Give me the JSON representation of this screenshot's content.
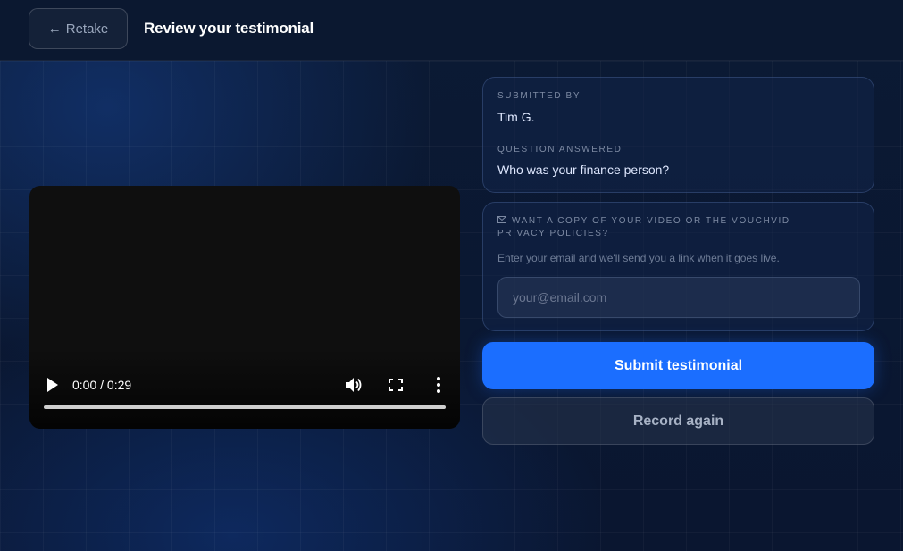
{
  "header": {
    "retake_label": "Retake",
    "title": "Review your testimonial"
  },
  "video": {
    "time": "0:00 / 0:29",
    "progress": 0
  },
  "info": {
    "submitted_by_label": "SUBMITTED BY",
    "submitted_by": "Tim G.",
    "question_label": "QUESTION ANSWERED",
    "question": "Who was your finance person?"
  },
  "email": {
    "title": "WANT A COPY OF YOUR VIDEO OR THE VOUCHVID PRIVACY POLICIES?",
    "description": "Enter your email and we'll send you a link when it goes live.",
    "placeholder": "your@email.com",
    "value": ""
  },
  "actions": {
    "submit_label": "Submit testimonial",
    "record_again_label": "Record again"
  },
  "colors": {
    "accent": "#1b6eff",
    "background": "#0a1630"
  }
}
